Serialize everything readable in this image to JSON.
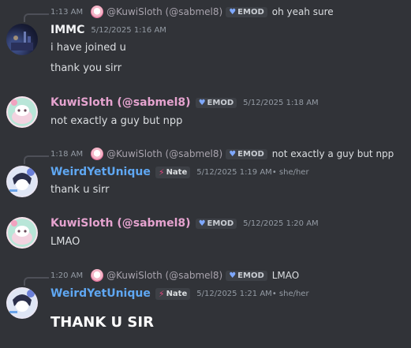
{
  "messages": {
    "reply1": {
      "time": "1:13 AM",
      "name": "@KuwiSloth (@sabmel8)",
      "badge": "EMOD",
      "text": "oh yeah sure"
    },
    "m1": {
      "author": "IMMC",
      "timestamp": "5/12/2025 1:16 AM",
      "lines": [
        "i have joined u",
        "thank you sirr"
      ]
    },
    "m2": {
      "author": "KuwiSloth (@sabmel8)",
      "badge": "EMOD",
      "timestamp": "5/12/2025 1:18 AM",
      "text": "not exactly a guy but npp"
    },
    "reply2": {
      "time": "1:18 AM",
      "name": "@KuwiSloth (@sabmel8)",
      "badge": "EMOD",
      "text": "not exactly a guy but npp"
    },
    "m3": {
      "author": "WeirdYetUnique",
      "tag": "Nate",
      "timestamp": "5/12/2025 1:19 AM",
      "pronouns": " • she/her",
      "text": "thank u sirr"
    },
    "m4": {
      "author": "KuwiSloth (@sabmel8)",
      "badge": "EMOD",
      "timestamp": "5/12/2025 1:20 AM",
      "text": "LMAO"
    },
    "reply3": {
      "time": "1:20 AM",
      "name": "@KuwiSloth (@sabmel8)",
      "badge": "EMOD",
      "text": "LMAO"
    },
    "m5": {
      "author": "WeirdYetUnique",
      "tag": "Nate",
      "timestamp": "5/12/2025 1:21 AM",
      "pronouns": " • she/her",
      "text": "THANK U SIR"
    }
  },
  "icons": {
    "emod_badge": "heart-shield-icon",
    "nate_tag": "lightning-bolt-icon"
  },
  "colors": {
    "background": "#313338",
    "kuwi_name": "#e5a3cf",
    "weird_name": "#5fa7f2"
  }
}
